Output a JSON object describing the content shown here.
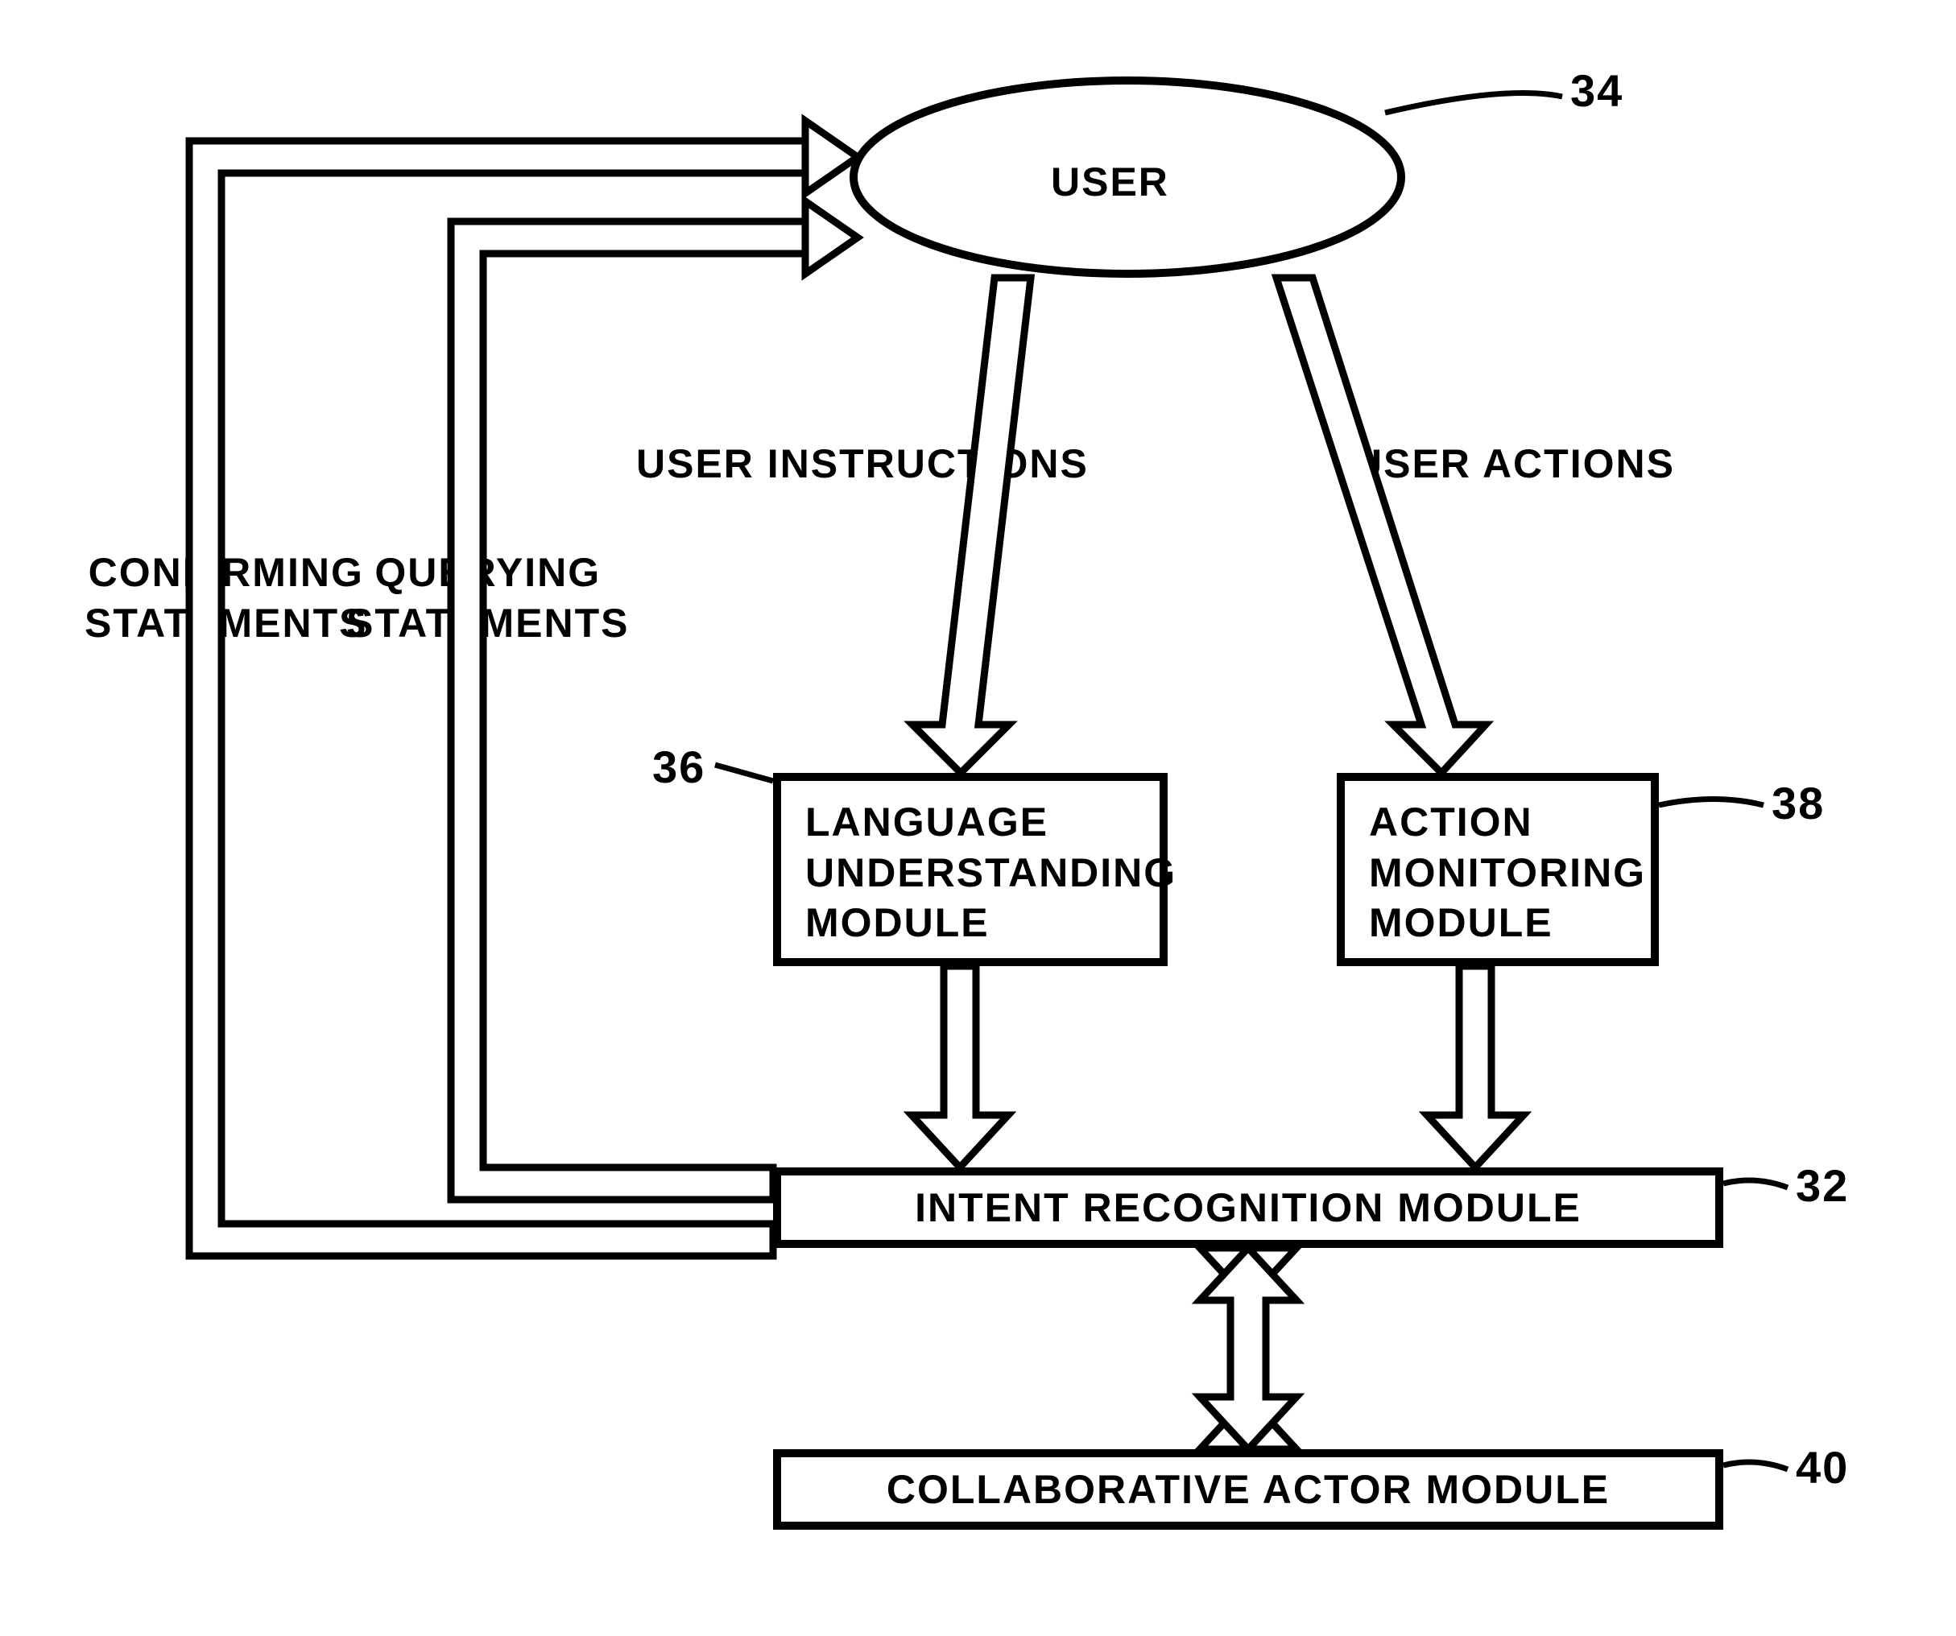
{
  "nodes": {
    "user": "USER",
    "language_module": "LANGUAGE\nUNDERSTANDING\nMODULE",
    "action_module": "ACTION\nMONITORING\nMODULE",
    "intent_module": "INTENT RECOGNITION MODULE",
    "collab_module": "COLLABORATIVE ACTOR MODULE"
  },
  "edges": {
    "confirming": "CONFIRMING\nSTATEMENTS",
    "querying": "QUERYING\nSTATEMENTS",
    "user_instructions": "USER INSTRUCTIONS",
    "user_actions": "USER ACTIONS"
  },
  "refs": {
    "user": "34",
    "language": "36",
    "action": "38",
    "intent": "32",
    "collab": "40"
  }
}
